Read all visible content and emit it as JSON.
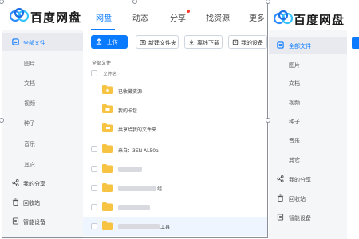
{
  "window_main": {
    "app_name": "百度网盘",
    "tabs": [
      {
        "label": "网盘",
        "active": true
      },
      {
        "label": "动态",
        "active": false
      },
      {
        "label": "分享",
        "active": false,
        "badge": true
      },
      {
        "label": "找资源",
        "active": false
      },
      {
        "label": "更多",
        "active": false
      }
    ],
    "sidebar": {
      "items": [
        {
          "label": "全部文件",
          "icon": "file-icon",
          "active": true
        },
        {
          "label": "图片",
          "sub": true
        },
        {
          "label": "文档",
          "sub": true
        },
        {
          "label": "视频",
          "sub": true
        },
        {
          "label": "种子",
          "sub": true
        },
        {
          "label": "音乐",
          "sub": true
        },
        {
          "label": "其它",
          "sub": true
        },
        {
          "label": "我的分享",
          "icon": "share-icon"
        },
        {
          "label": "回收站",
          "icon": "trash-icon"
        },
        {
          "label": "智能设备",
          "icon": "device-icon"
        }
      ]
    },
    "toolbar": {
      "upload": "上传",
      "new_folder": "新建文件夹",
      "offline_download": "离线下载",
      "my_device": "我的设备"
    },
    "breadcrumb": "全部文件",
    "file_header": "文件名",
    "files": [
      {
        "name": "已收藏资源",
        "special": true
      },
      {
        "name": "我的卡包",
        "special": true
      },
      {
        "name": "共享给我的文件夹",
        "special": true
      },
      {
        "name": "来自：3EN AL50a",
        "special": false
      },
      {
        "name": "",
        "special": false
      },
      {
        "name": "",
        "special": false
      },
      {
        "name": "",
        "special": false
      },
      {
        "name": "",
        "special": false
      }
    ],
    "partial_text": {
      "row6_suffix": "组",
      "row8_suffix": "工具"
    }
  },
  "window_second": {
    "app_name": "百度网盘",
    "sidebar": {
      "items": [
        {
          "label": "全部文件",
          "active": true
        },
        {
          "label": "图片"
        },
        {
          "label": "文档"
        },
        {
          "label": "视频"
        },
        {
          "label": "种子"
        },
        {
          "label": "音乐"
        },
        {
          "label": "其它"
        },
        {
          "label": "我的分享"
        },
        {
          "label": "回收站"
        },
        {
          "label": "智能设备"
        }
      ]
    }
  },
  "colors": {
    "accent": "#0a7bff",
    "folder": "#f6c343",
    "sidebar_bg": "#f5f6f8"
  }
}
